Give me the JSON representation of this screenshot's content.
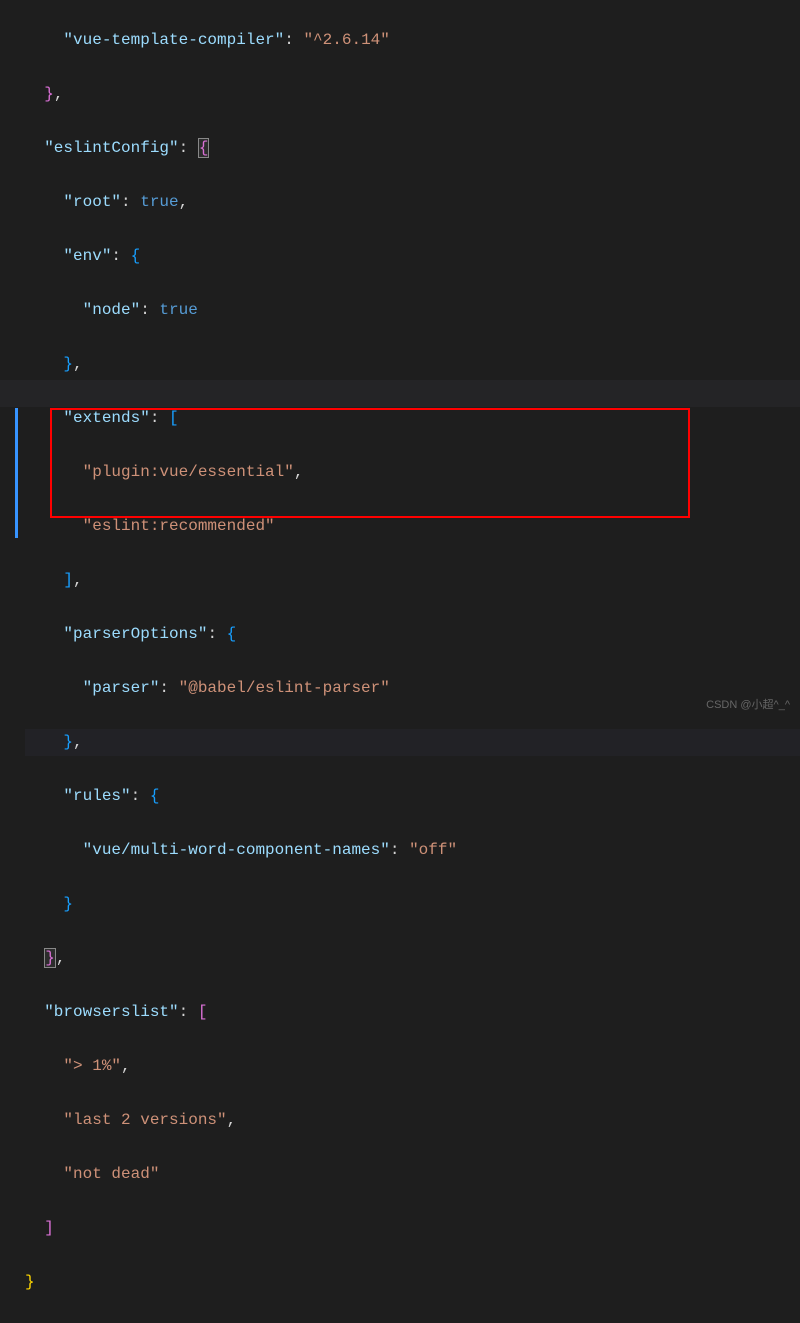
{
  "code": {
    "line1_key": "\"vue-template-compiler\"",
    "line1_val": "\"^2.6.14\"",
    "line3_key": "\"eslintConfig\"",
    "line4_key": "\"root\"",
    "line4_val": "true",
    "line5_key": "\"env\"",
    "line6_key": "\"node\"",
    "line6_val": "true",
    "line8_key": "\"extends\"",
    "line9_val": "\"plugin:vue/essential\"",
    "line10_val": "\"eslint:recommended\"",
    "line12_key": "\"parserOptions\"",
    "line13_key": "\"parser\"",
    "line13_val": "\"@babel/eslint-parser\"",
    "line15_key": "\"rules\"",
    "line16_key": "\"vue/multi-word-component-names\"",
    "line16_val": "\"off\"",
    "line19_key": "\"browserslist\"",
    "line20_val": "\"> 1%\"",
    "line21_val": "\"last 2 versions\"",
    "line22_val": "\"not dead\""
  },
  "watermark": "CSDN @小超^_^"
}
